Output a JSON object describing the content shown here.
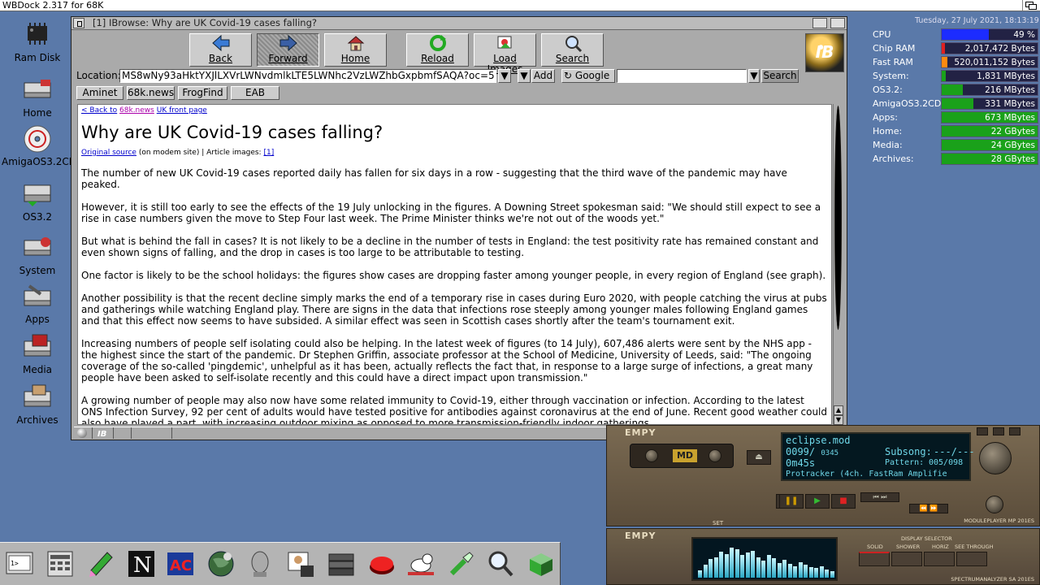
{
  "screen": {
    "title": "WBDock 2.317 for 68K"
  },
  "desktop_icons": [
    {
      "label": "Ram Disk"
    },
    {
      "label": "Home"
    },
    {
      "label": "AmigaOS3.2CD"
    },
    {
      "label": "OS3.2"
    },
    {
      "label": "System"
    },
    {
      "label": "Apps"
    },
    {
      "label": "Media"
    },
    {
      "label": "Archives"
    }
  ],
  "browser": {
    "window_title": "[1] IBrowse: Why are UK Covid-19 cases falling?",
    "toolbar": {
      "back": "Back",
      "forward": "Forward",
      "home": "Home",
      "reload": "Reload",
      "load_images": "Load Images",
      "search": "Search"
    },
    "location_label": "Location:",
    "location_value": "MS8wNy93aHktYXJlLXVrLWNvdmlkLTE5LWNhc2VzLWZhbGxpbmfSAQA?oc=5",
    "add_label": "Add",
    "search_engine": "Google",
    "search_value": "",
    "search_button": "Search",
    "hotlist": [
      "Aminet",
      "68k.news",
      "FrogFind",
      "EAB"
    ],
    "page": {
      "back_link": "< Back to",
      "back_site": "68k.news",
      "front_link": "UK front page",
      "heading": "Why are UK Covid-19 cases falling?",
      "original_source": "Original source",
      "meta_suffix": "(on modem site) | Article images:",
      "image_link": "[1]",
      "paragraphs": [
        "The number of new UK Covid-19 cases reported daily has fallen for six days in a row - suggesting that the third wave of the pandemic may have peaked.",
        "However, it is still too early to see the effects of the 19 July unlocking in the figures. A Downing Street spokesman said: \"We should still expect to see a rise in case numbers given the move to Step Four last week. The Prime Minister thinks we're not out of the woods yet.\"",
        "But what is behind the fall in cases? It is not likely to be a decline in the number of tests in England: the test positivity rate has remained constant and even shown signs of falling, and the drop in cases is too large to be attributable to testing.",
        "One factor is likely to be the school holidays: the figures show cases are dropping faster among younger people, in every region of England (see graph).",
        "Another possibility is that the recent decline simply marks the end of a temporary rise in cases during Euro 2020, with people catching the virus at pubs and gatherings while watching England play. There are signs in the data that infections rose steeply among younger males following England games and that this effect now seems to have subsided. A similar effect was seen in Scottish cases shortly after the team's tournament exit.",
        "Increasing numbers of people self isolating could also be helping. In the latest week of figures (to 14 July), 607,486 alerts were sent by the NHS app - the highest since the start of the pandemic. Dr Stephen Griffin, associate professor at the School of Medicine, University of Leeds, said: \"The ongoing coverage of the so-called 'pingdemic', unhelpful as it has been, actually reflects the fact that, in response to a large surge of infections, a great many people have been asked to self-isolate recently and this could have a direct impact upon transmission.\"",
        "A growing number of people may also now have some related immunity to Covid-19, either through vaccination or infection. According to the latest ONS Infection Survey, 92 per cent of adults would have tested positive for antibodies against coronavirus at the end of June. Recent good weather could also have played a part, with increasing outdoor mixing as opposed to more transmission-friendly indoor gatherings."
      ]
    }
  },
  "monitor": {
    "datetime": "Tuesday, 27 July 2021, 18:13:19",
    "rows": [
      {
        "name": "CPU",
        "value": "49 %",
        "fraction": 0.49,
        "color": "#1c2cff"
      },
      {
        "name": "Chip RAM",
        "value": "2,017,472 Bytes",
        "fraction": 0.03,
        "color": "#e02020"
      },
      {
        "name": "Fast RAM",
        "value": "520,011,152 Bytes",
        "fraction": 0.06,
        "color": "#ff8a10"
      },
      {
        "name": "System:",
        "value": "1,831 MBytes",
        "fraction": 0.04,
        "color": "#1aa11a"
      },
      {
        "name": "OS3.2:",
        "value": "216 MBytes",
        "fraction": 0.22,
        "color": "#1aa11a"
      },
      {
        "name": "AmigaOS3.2CD:",
        "value": "331 MBytes",
        "fraction": 0.33,
        "color": "#1aa11a"
      },
      {
        "name": "Apps:",
        "value": "673 MBytes",
        "fraction": 1.0,
        "color": "#1aa11a"
      },
      {
        "name": "Home:",
        "value": "22 GBytes",
        "fraction": 1.0,
        "color": "#1aa11a"
      },
      {
        "name": "Media:",
        "value": "24 GBytes",
        "fraction": 1.0,
        "color": "#1aa11a"
      },
      {
        "name": "Archives:",
        "value": "28 GBytes",
        "fraction": 1.0,
        "color": "#1aa11a"
      }
    ]
  },
  "player": {
    "brand": "EMPY",
    "file": "eclipse.mod",
    "position": "0099",
    "total": "0345",
    "time": "0m45s",
    "subsong_label": "Subsong:",
    "subsong_value": "---/---",
    "pattern_label": "Pattern:",
    "pattern_value": "005/098",
    "format": "Protracker (4ch.",
    "output": "FastRam Amplifie",
    "set_label": "SET",
    "footer": "MODULEPLAYER MP 201ES"
  },
  "analyzer": {
    "brand": "EMPY",
    "display_selector": "DISPLAY SELECTOR",
    "modes": [
      "SOLID",
      "SHOWER",
      "HORIZ",
      "SEE THROUGH"
    ],
    "footer": "SPECTRUMANALYZER SA 201ES",
    "levels": [
      0.2,
      0.35,
      0.5,
      0.55,
      0.7,
      0.62,
      0.8,
      0.75,
      0.6,
      0.68,
      0.72,
      0.55,
      0.45,
      0.6,
      0.52,
      0.4,
      0.48,
      0.36,
      0.3,
      0.42,
      0.34,
      0.28,
      0.25,
      0.3,
      0.22,
      0.18
    ]
  }
}
